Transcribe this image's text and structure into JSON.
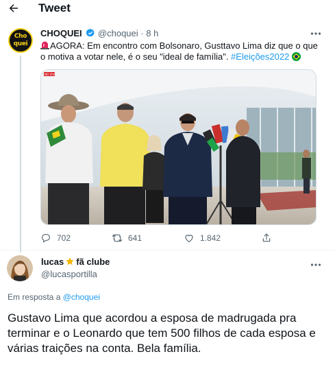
{
  "header": {
    "title": "Tweet"
  },
  "tweet": {
    "author_name": "CHOQUEI",
    "author_handle": "@choquei",
    "time": "· 8 h",
    "avatar_text_top": "Cho",
    "avatar_text_bottom": "quei",
    "text_main": "AGORA: Em encontro com Bolsonaro, Gusttavo Lima diz que o que o motiva a votar nele, é o seu \"ideal de família\". ",
    "hashtag": "#Eleições2022",
    "photo_badge": "NO VIVO",
    "stats": {
      "replies": "702",
      "retweets": "641",
      "likes": "1.842"
    }
  },
  "reply": {
    "author_name": "lucas",
    "author_name_suffix": "fã clube",
    "author_handle": "@lucasportilla",
    "reply_prefix": "Em resposta a ",
    "reply_mention": "@choquei",
    "text": "Gustavo Lima que acordou a esposa de madrugada pra terminar e o Leonardo que tem 500 filhos de cada esposa e várias traições na conta. Bela família."
  },
  "colors": {
    "accent": "#1d9bf0",
    "muted": "#536471",
    "brand_yellow": "#f7d117"
  },
  "icons": [
    "back-arrow-icon",
    "verified-icon",
    "more-icon",
    "siren-icon",
    "brazil-flag-icon",
    "reply-icon",
    "retweet-icon",
    "like-icon",
    "share-icon",
    "star-icon"
  ]
}
